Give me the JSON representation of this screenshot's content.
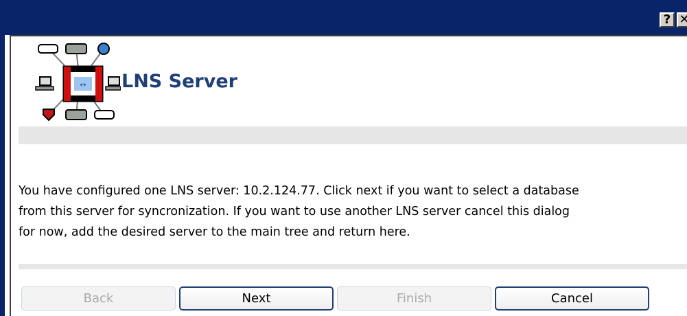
{
  "window": {
    "help_button": "?",
    "close_button": "✕"
  },
  "header": {
    "title": "LNS Server",
    "logo_icon": "lns-network-icon"
  },
  "message": {
    "text": "You have configured one LNS server: 10.2.124.77. Click next if you want to select a database\nfrom this server for syncronization. If you want to use another LNS server cancel this dialog\nfor now, add the desired server to the main tree and return here."
  },
  "buttons": {
    "back": "Back",
    "next": "Next",
    "finish": "Finish",
    "cancel": "Cancel"
  },
  "colors": {
    "titlebar": "#0a246a",
    "title_text": "#1f3f77",
    "band": "#e6e6e6"
  }
}
